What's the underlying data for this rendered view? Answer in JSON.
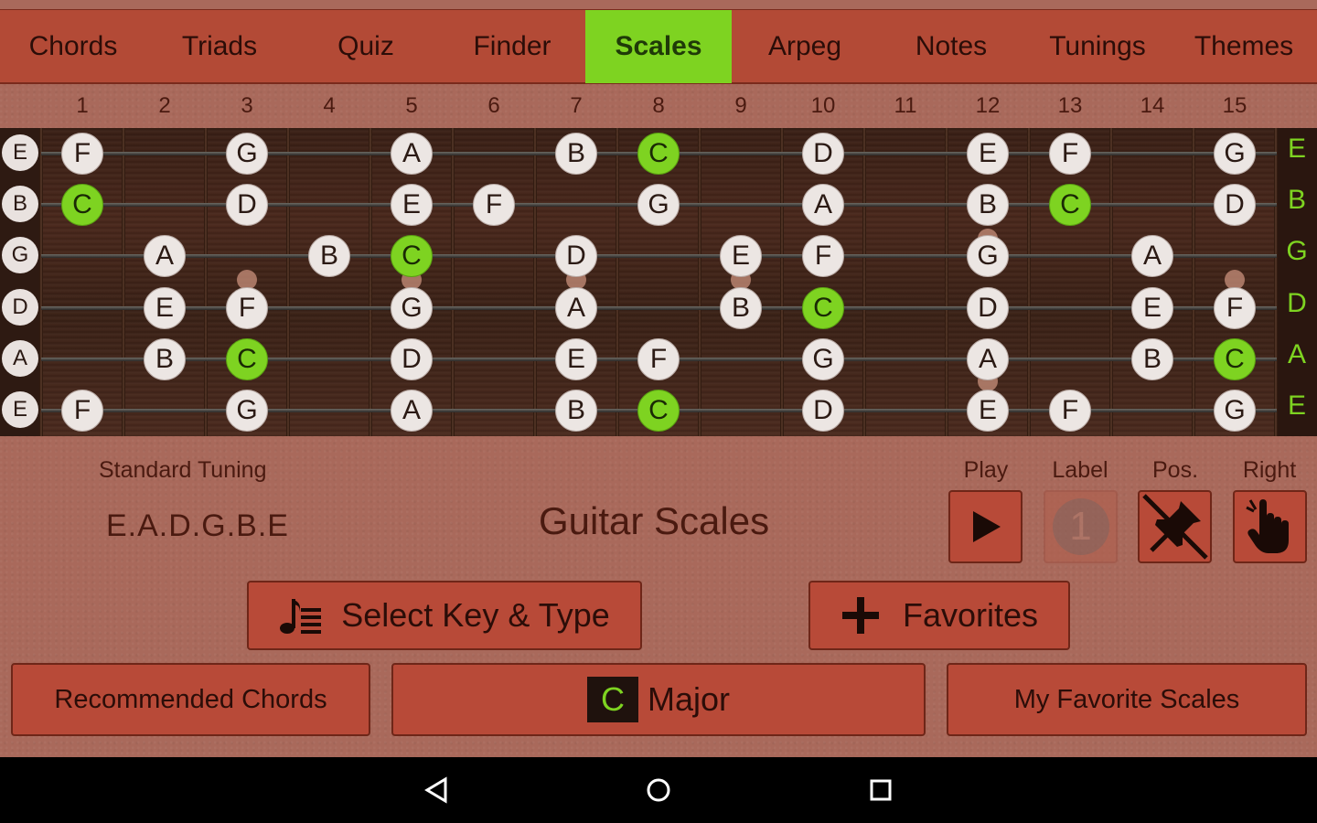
{
  "tabs": [
    {
      "label": "Chords",
      "active": false
    },
    {
      "label": "Triads",
      "active": false
    },
    {
      "label": "Quiz",
      "active": false
    },
    {
      "label": "Finder",
      "active": false
    },
    {
      "label": "Scales",
      "active": true
    },
    {
      "label": "Arpeg",
      "active": false
    },
    {
      "label": "Notes",
      "active": false
    },
    {
      "label": "Tunings",
      "active": false
    },
    {
      "label": "Themes",
      "active": false
    }
  ],
  "fret_numbers": [
    "1",
    "2",
    "3",
    "4",
    "5",
    "6",
    "7",
    "8",
    "9",
    "10",
    "11",
    "12",
    "13",
    "14",
    "15"
  ],
  "strings": {
    "open_left": [
      "E",
      "B",
      "G",
      "D",
      "A",
      "E"
    ],
    "open_right": [
      "E",
      "B",
      "G",
      "D",
      "A",
      "E"
    ]
  },
  "fretboard_notes": [
    [
      [
        1,
        "F"
      ],
      [
        3,
        "G"
      ],
      [
        5,
        "A"
      ],
      [
        7,
        "B"
      ],
      [
        8,
        "C"
      ],
      [
        10,
        "D"
      ],
      [
        12,
        "E"
      ],
      [
        13,
        "F"
      ],
      [
        15,
        "G"
      ]
    ],
    [
      [
        1,
        "C"
      ],
      [
        3,
        "D"
      ],
      [
        5,
        "E"
      ],
      [
        6,
        "F"
      ],
      [
        8,
        "G"
      ],
      [
        10,
        "A"
      ],
      [
        12,
        "B"
      ],
      [
        13,
        "C"
      ],
      [
        15,
        "D"
      ]
    ],
    [
      [
        2,
        "A"
      ],
      [
        4,
        "B"
      ],
      [
        5,
        "C"
      ],
      [
        7,
        "D"
      ],
      [
        9,
        "E"
      ],
      [
        10,
        "F"
      ],
      [
        12,
        "G"
      ],
      [
        14,
        "A"
      ]
    ],
    [
      [
        2,
        "E"
      ],
      [
        3,
        "F"
      ],
      [
        5,
        "G"
      ],
      [
        7,
        "A"
      ],
      [
        9,
        "B"
      ],
      [
        10,
        "C"
      ],
      [
        12,
        "D"
      ],
      [
        14,
        "E"
      ],
      [
        15,
        "F"
      ]
    ],
    [
      [
        2,
        "B"
      ],
      [
        3,
        "C"
      ],
      [
        5,
        "D"
      ],
      [
        7,
        "E"
      ],
      [
        8,
        "F"
      ],
      [
        10,
        "G"
      ],
      [
        12,
        "A"
      ],
      [
        14,
        "B"
      ],
      [
        15,
        "C"
      ]
    ],
    [
      [
        1,
        "F"
      ],
      [
        3,
        "G"
      ],
      [
        5,
        "A"
      ],
      [
        7,
        "B"
      ],
      [
        8,
        "C"
      ],
      [
        10,
        "D"
      ],
      [
        12,
        "E"
      ],
      [
        13,
        "F"
      ],
      [
        15,
        "G"
      ]
    ]
  ],
  "root_note": "C",
  "tuning": {
    "title": "Standard Tuning",
    "value": "E.A.D.G.B.E"
  },
  "app_title": "Guitar Scales",
  "controls": {
    "play_label": "Play",
    "label_label": "Label",
    "label_value": "1",
    "pos_label": "Pos.",
    "right_label": "Right"
  },
  "buttons": {
    "select_key_type": "Select Key & Type",
    "favorites": "Favorites",
    "recommended_chords": "Recommended Chords",
    "scale_key": "C",
    "scale_type": "Major",
    "my_favorite_scales": "My Favorite Scales"
  },
  "colors": {
    "accent_green": "#7ed321",
    "tab_bar": "#b34a36",
    "button": "#b84a38",
    "background": "#a9695b"
  },
  "icons": {
    "play": "play-icon",
    "label": "number-one-circle-icon",
    "pos": "pin-off-icon",
    "right": "hand-pointer-icon",
    "select_key": "music-notes-list-icon",
    "favorites": "plus-icon"
  }
}
